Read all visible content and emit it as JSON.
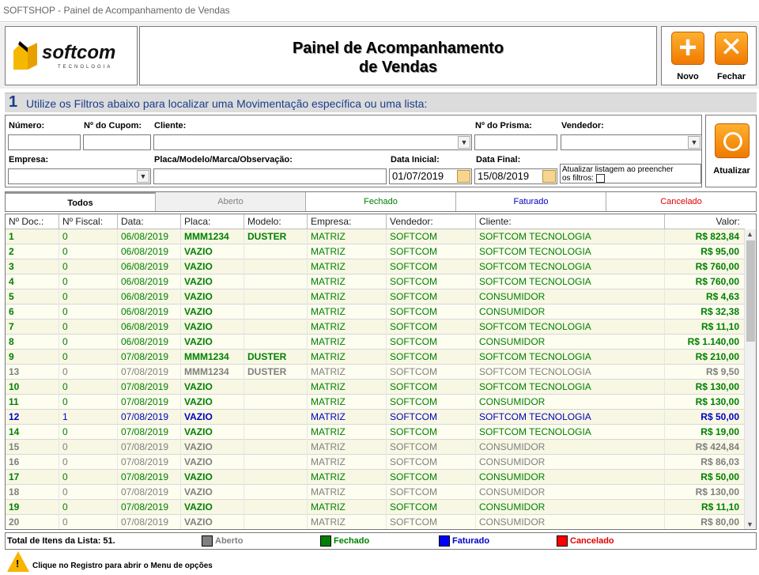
{
  "window": {
    "title": "SOFTSHOP - Painel de Acompanhamento  de Vendas"
  },
  "logo": {
    "name": "softcom",
    "tagline": "TECNOLOGIA"
  },
  "page": {
    "title_line1": "Painel de Acompanhamento",
    "title_line2": "de Vendas"
  },
  "toolbar": {
    "novo_label": "Novo",
    "fechar_label": "Fechar",
    "novo_icon": "plus-icon",
    "fechar_icon": "close-icon"
  },
  "section": {
    "number": "1",
    "text": "Utilize os Filtros abaixo para localizar uma Movimentação específica ou uma lista:"
  },
  "filters": {
    "numero_label": "Número:",
    "numero_value": "",
    "cupom_label": "Nº do Cupom:",
    "cupom_value": "",
    "cliente_label": "Cliente:",
    "cliente_value": "",
    "prisma_label": "Nº do Prisma:",
    "prisma_value": "",
    "vendedor_label": "Vendedor:",
    "vendedor_value": "",
    "empresa_label": "Empresa:",
    "empresa_value": "",
    "placa_label": "Placa/Modelo/Marca/Observação:",
    "placa_value": "",
    "data_inicial_label": "Data Inicial:",
    "data_inicial_value": "01/07/2019",
    "data_final_label": "Data Final:",
    "data_final_value": "15/08/2019",
    "auto_update_label_1": "Atualizar listagem ao preencher",
    "auto_update_label_2": "os filtros:",
    "auto_update_checked": false
  },
  "atualizar": {
    "label": "Atualizar",
    "icon": "refresh-icon"
  },
  "tabs": [
    {
      "label": "Todos",
      "color": "#000000"
    },
    {
      "label": "Aberto",
      "color": "#808080"
    },
    {
      "label": "Fechado",
      "color": "#008000"
    },
    {
      "label": "Faturado",
      "color": "#0000c0"
    },
    {
      "label": "Cancelado",
      "color": "#e00000"
    }
  ],
  "table": {
    "columns": [
      "Nº Doc.:",
      "Nº Fiscal:",
      "Data:",
      "Placa:",
      "Modelo:",
      "Empresa:",
      "Vendedor:",
      "Cliente:",
      "Valor:"
    ],
    "rows": [
      {
        "doc": "1",
        "fiscal": "0",
        "data": "06/08/2019",
        "placa": "MMM1234",
        "modelo": "DUSTER",
        "empresa": "MATRIZ",
        "vendedor": "SOFTCOM",
        "cliente": "SOFTCOM TECNOLOGIA",
        "valor": "R$ 823,84",
        "status": "Fechado"
      },
      {
        "doc": "2",
        "fiscal": "0",
        "data": "06/08/2019",
        "placa": "VAZIO",
        "modelo": "",
        "empresa": "MATRIZ",
        "vendedor": "SOFTCOM",
        "cliente": "SOFTCOM TECNOLOGIA",
        "valor": "R$ 95,00",
        "status": "Fechado"
      },
      {
        "doc": "3",
        "fiscal": "0",
        "data": "06/08/2019",
        "placa": "VAZIO",
        "modelo": "",
        "empresa": "MATRIZ",
        "vendedor": "SOFTCOM",
        "cliente": "SOFTCOM TECNOLOGIA",
        "valor": "R$ 760,00",
        "status": "Fechado"
      },
      {
        "doc": "4",
        "fiscal": "0",
        "data": "06/08/2019",
        "placa": "VAZIO",
        "modelo": "",
        "empresa": "MATRIZ",
        "vendedor": "SOFTCOM",
        "cliente": "SOFTCOM TECNOLOGIA",
        "valor": "R$ 760,00",
        "status": "Fechado"
      },
      {
        "doc": "5",
        "fiscal": "0",
        "data": "06/08/2019",
        "placa": "VAZIO",
        "modelo": "",
        "empresa": "MATRIZ",
        "vendedor": "SOFTCOM",
        "cliente": "CONSUMIDOR",
        "valor": "R$ 4,63",
        "status": "Fechado"
      },
      {
        "doc": "6",
        "fiscal": "0",
        "data": "06/08/2019",
        "placa": "VAZIO",
        "modelo": "",
        "empresa": "MATRIZ",
        "vendedor": "SOFTCOM",
        "cliente": "CONSUMIDOR",
        "valor": "R$ 32,38",
        "status": "Fechado"
      },
      {
        "doc": "7",
        "fiscal": "0",
        "data": "06/08/2019",
        "placa": "VAZIO",
        "modelo": "",
        "empresa": "MATRIZ",
        "vendedor": "SOFTCOM",
        "cliente": "SOFTCOM TECNOLOGIA",
        "valor": "R$ 11,10",
        "status": "Fechado"
      },
      {
        "doc": "8",
        "fiscal": "0",
        "data": "06/08/2019",
        "placa": "VAZIO",
        "modelo": "",
        "empresa": "MATRIZ",
        "vendedor": "SOFTCOM",
        "cliente": "CONSUMIDOR",
        "valor": "R$ 1.140,00",
        "status": "Fechado"
      },
      {
        "doc": "9",
        "fiscal": "0",
        "data": "07/08/2019",
        "placa": "MMM1234",
        "modelo": "DUSTER",
        "empresa": "MATRIZ",
        "vendedor": "SOFTCOM",
        "cliente": "SOFTCOM TECNOLOGIA",
        "valor": "R$ 210,00",
        "status": "Fechado"
      },
      {
        "doc": "13",
        "fiscal": "0",
        "data": "07/08/2019",
        "placa": "MMM1234",
        "modelo": "DUSTER",
        "empresa": "MATRIZ",
        "vendedor": "SOFTCOM",
        "cliente": "SOFTCOM TECNOLOGIA",
        "valor": "R$ 9,50",
        "status": "Aberto"
      },
      {
        "doc": "10",
        "fiscal": "0",
        "data": "07/08/2019",
        "placa": "VAZIO",
        "modelo": "",
        "empresa": "MATRIZ",
        "vendedor": "SOFTCOM",
        "cliente": "SOFTCOM TECNOLOGIA",
        "valor": "R$ 130,00",
        "status": "Fechado"
      },
      {
        "doc": "11",
        "fiscal": "0",
        "data": "07/08/2019",
        "placa": "VAZIO",
        "modelo": "",
        "empresa": "MATRIZ",
        "vendedor": "SOFTCOM",
        "cliente": "CONSUMIDOR",
        "valor": "R$ 130,00",
        "status": "Fechado"
      },
      {
        "doc": "12",
        "fiscal": "1",
        "data": "07/08/2019",
        "placa": "VAZIO",
        "modelo": "",
        "empresa": "MATRIZ",
        "vendedor": "SOFTCOM",
        "cliente": "SOFTCOM TECNOLOGIA",
        "valor": "R$ 50,00",
        "status": "Faturado"
      },
      {
        "doc": "14",
        "fiscal": "0",
        "data": "07/08/2019",
        "placa": "VAZIO",
        "modelo": "",
        "empresa": "MATRIZ",
        "vendedor": "SOFTCOM",
        "cliente": "SOFTCOM TECNOLOGIA",
        "valor": "R$ 19,00",
        "status": "Fechado"
      },
      {
        "doc": "15",
        "fiscal": "0",
        "data": "07/08/2019",
        "placa": "VAZIO",
        "modelo": "",
        "empresa": "MATRIZ",
        "vendedor": "SOFTCOM",
        "cliente": "CONSUMIDOR",
        "valor": "R$ 424,84",
        "status": "Aberto"
      },
      {
        "doc": "16",
        "fiscal": "0",
        "data": "07/08/2019",
        "placa": "VAZIO",
        "modelo": "",
        "empresa": "MATRIZ",
        "vendedor": "SOFTCOM",
        "cliente": "CONSUMIDOR",
        "valor": "R$ 86,03",
        "status": "Aberto"
      },
      {
        "doc": "17",
        "fiscal": "0",
        "data": "07/08/2019",
        "placa": "VAZIO",
        "modelo": "",
        "empresa": "MATRIZ",
        "vendedor": "SOFTCOM",
        "cliente": "CONSUMIDOR",
        "valor": "R$ 50,00",
        "status": "Fechado"
      },
      {
        "doc": "18",
        "fiscal": "0",
        "data": "07/08/2019",
        "placa": "VAZIO",
        "modelo": "",
        "empresa": "MATRIZ",
        "vendedor": "SOFTCOM",
        "cliente": "CONSUMIDOR",
        "valor": "R$ 130,00",
        "status": "Aberto"
      },
      {
        "doc": "19",
        "fiscal": "0",
        "data": "07/08/2019",
        "placa": "VAZIO",
        "modelo": "",
        "empresa": "MATRIZ",
        "vendedor": "SOFTCOM",
        "cliente": "CONSUMIDOR",
        "valor": "R$ 11,10",
        "status": "Fechado"
      },
      {
        "doc": "20",
        "fiscal": "0",
        "data": "07/08/2019",
        "placa": "VAZIO",
        "modelo": "",
        "empresa": "MATRIZ",
        "vendedor": "SOFTCOM",
        "cliente": "CONSUMIDOR",
        "valor": "R$ 80,00",
        "status": "Aberto"
      }
    ]
  },
  "status_colors": {
    "Aberto": "#808080",
    "Fechado": "#008000",
    "Faturado": "#0000c0",
    "Cancelado": "#e00000"
  },
  "footer": {
    "total_label": "Total de Itens da Lista: 51.",
    "legend": [
      {
        "label": "Aberto",
        "color": "#808080"
      },
      {
        "label": "Fechado",
        "color": "#008000"
      },
      {
        "label": "Faturado",
        "color": "#0000ff"
      },
      {
        "label": "Cancelado",
        "color": "#ff0000"
      }
    ],
    "hint": "Clique no Registro para abrir o Menu de opções",
    "hint_icon": "warning-icon"
  }
}
